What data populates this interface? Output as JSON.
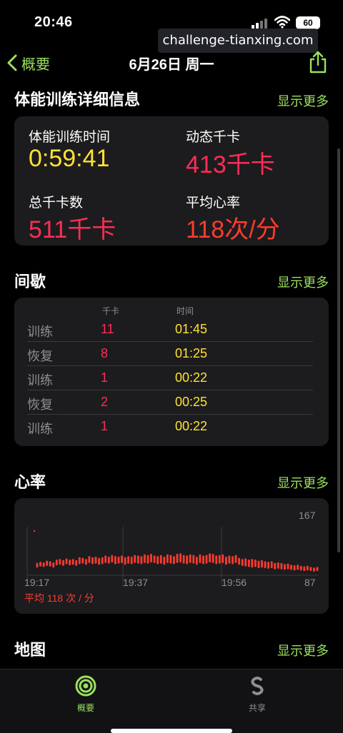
{
  "status": {
    "time": "20:46",
    "battery": "60"
  },
  "watermark": "challenge-tianxing.com",
  "nav": {
    "back_label": "概要",
    "title": "6月26日 周一"
  },
  "workout": {
    "title": "体能训练详细信息",
    "more": "显示更多",
    "metrics": [
      {
        "label": "体能训练时间",
        "value": "0:59:41",
        "color": "#ffe234"
      },
      {
        "label": "动态千卡",
        "value": "413千卡",
        "color": "#ff2d55"
      },
      {
        "label": "总千卡数",
        "value": "511千卡",
        "color": "#ff2d55"
      },
      {
        "label": "平均心率",
        "value": "118次/分",
        "color": "#ff3b30"
      }
    ]
  },
  "intervals": {
    "title": "间歇",
    "more": "显示更多",
    "col_cal": "千卡",
    "col_time": "时间",
    "rows": [
      {
        "type": "训练",
        "cal": "11",
        "time": "01:45"
      },
      {
        "type": "恢复",
        "cal": "8",
        "time": "01:25"
      },
      {
        "type": "训练",
        "cal": "1",
        "time": "00:22"
      },
      {
        "type": "恢复",
        "cal": "2",
        "time": "00:25"
      },
      {
        "type": "训练",
        "cal": "1",
        "time": "00:22"
      }
    ]
  },
  "heart_rate": {
    "title": "心率",
    "more": "显示更多",
    "max_label": "167",
    "min_label": "87",
    "avg_label": "平均 118 次 / 分",
    "chart_data": {
      "type": "bar",
      "x_ticks": [
        "19:17",
        "19:37",
        "19:56"
      ],
      "ylim": [
        87,
        167
      ],
      "color": "#ff3b30",
      "series_lows": [
        98,
        100,
        99,
        101,
        100,
        98,
        102,
        103,
        101,
        104,
        102,
        103,
        101,
        104,
        105,
        103,
        106,
        104,
        105,
        103,
        104,
        106,
        105,
        107,
        104,
        105,
        106,
        103,
        105,
        104,
        106,
        105,
        104,
        106,
        105,
        107,
        106,
        104,
        105,
        103,
        106,
        105,
        104,
        106,
        107,
        105,
        104,
        106,
        105,
        103,
        106,
        104,
        105,
        107,
        106,
        104,
        105,
        106,
        103,
        105,
        104,
        106,
        103,
        101,
        100,
        99,
        98,
        99,
        97,
        98,
        97,
        96,
        97,
        95,
        96,
        95,
        94,
        95,
        94,
        93,
        94,
        93,
        92,
        93,
        92,
        91,
        92
      ],
      "series_highs": [
        106,
        108,
        107,
        110,
        109,
        107,
        112,
        113,
        111,
        114,
        112,
        113,
        111,
        116,
        115,
        113,
        118,
        116,
        117,
        115,
        116,
        119,
        117,
        120,
        118,
        117,
        119,
        116,
        118,
        117,
        120,
        119,
        118,
        121,
        120,
        122,
        119,
        118,
        120,
        117,
        121,
        120,
        118,
        122,
        123,
        120,
        119,
        121,
        120,
        117,
        121,
        119,
        120,
        123,
        122,
        119,
        120,
        121,
        117,
        119,
        118,
        120,
        115,
        113,
        114,
        112,
        113,
        112,
        110,
        111,
        109,
        108,
        109,
        106,
        107,
        106,
        104,
        105,
        103,
        102,
        103,
        101,
        100,
        101,
        99,
        98,
        99
      ]
    }
  },
  "map": {
    "title": "地图",
    "more": "显示更多"
  },
  "tabs": [
    {
      "label": "概要",
      "color": "#9be15d"
    },
    {
      "label": "共享",
      "color": "#8e8e93"
    }
  ]
}
